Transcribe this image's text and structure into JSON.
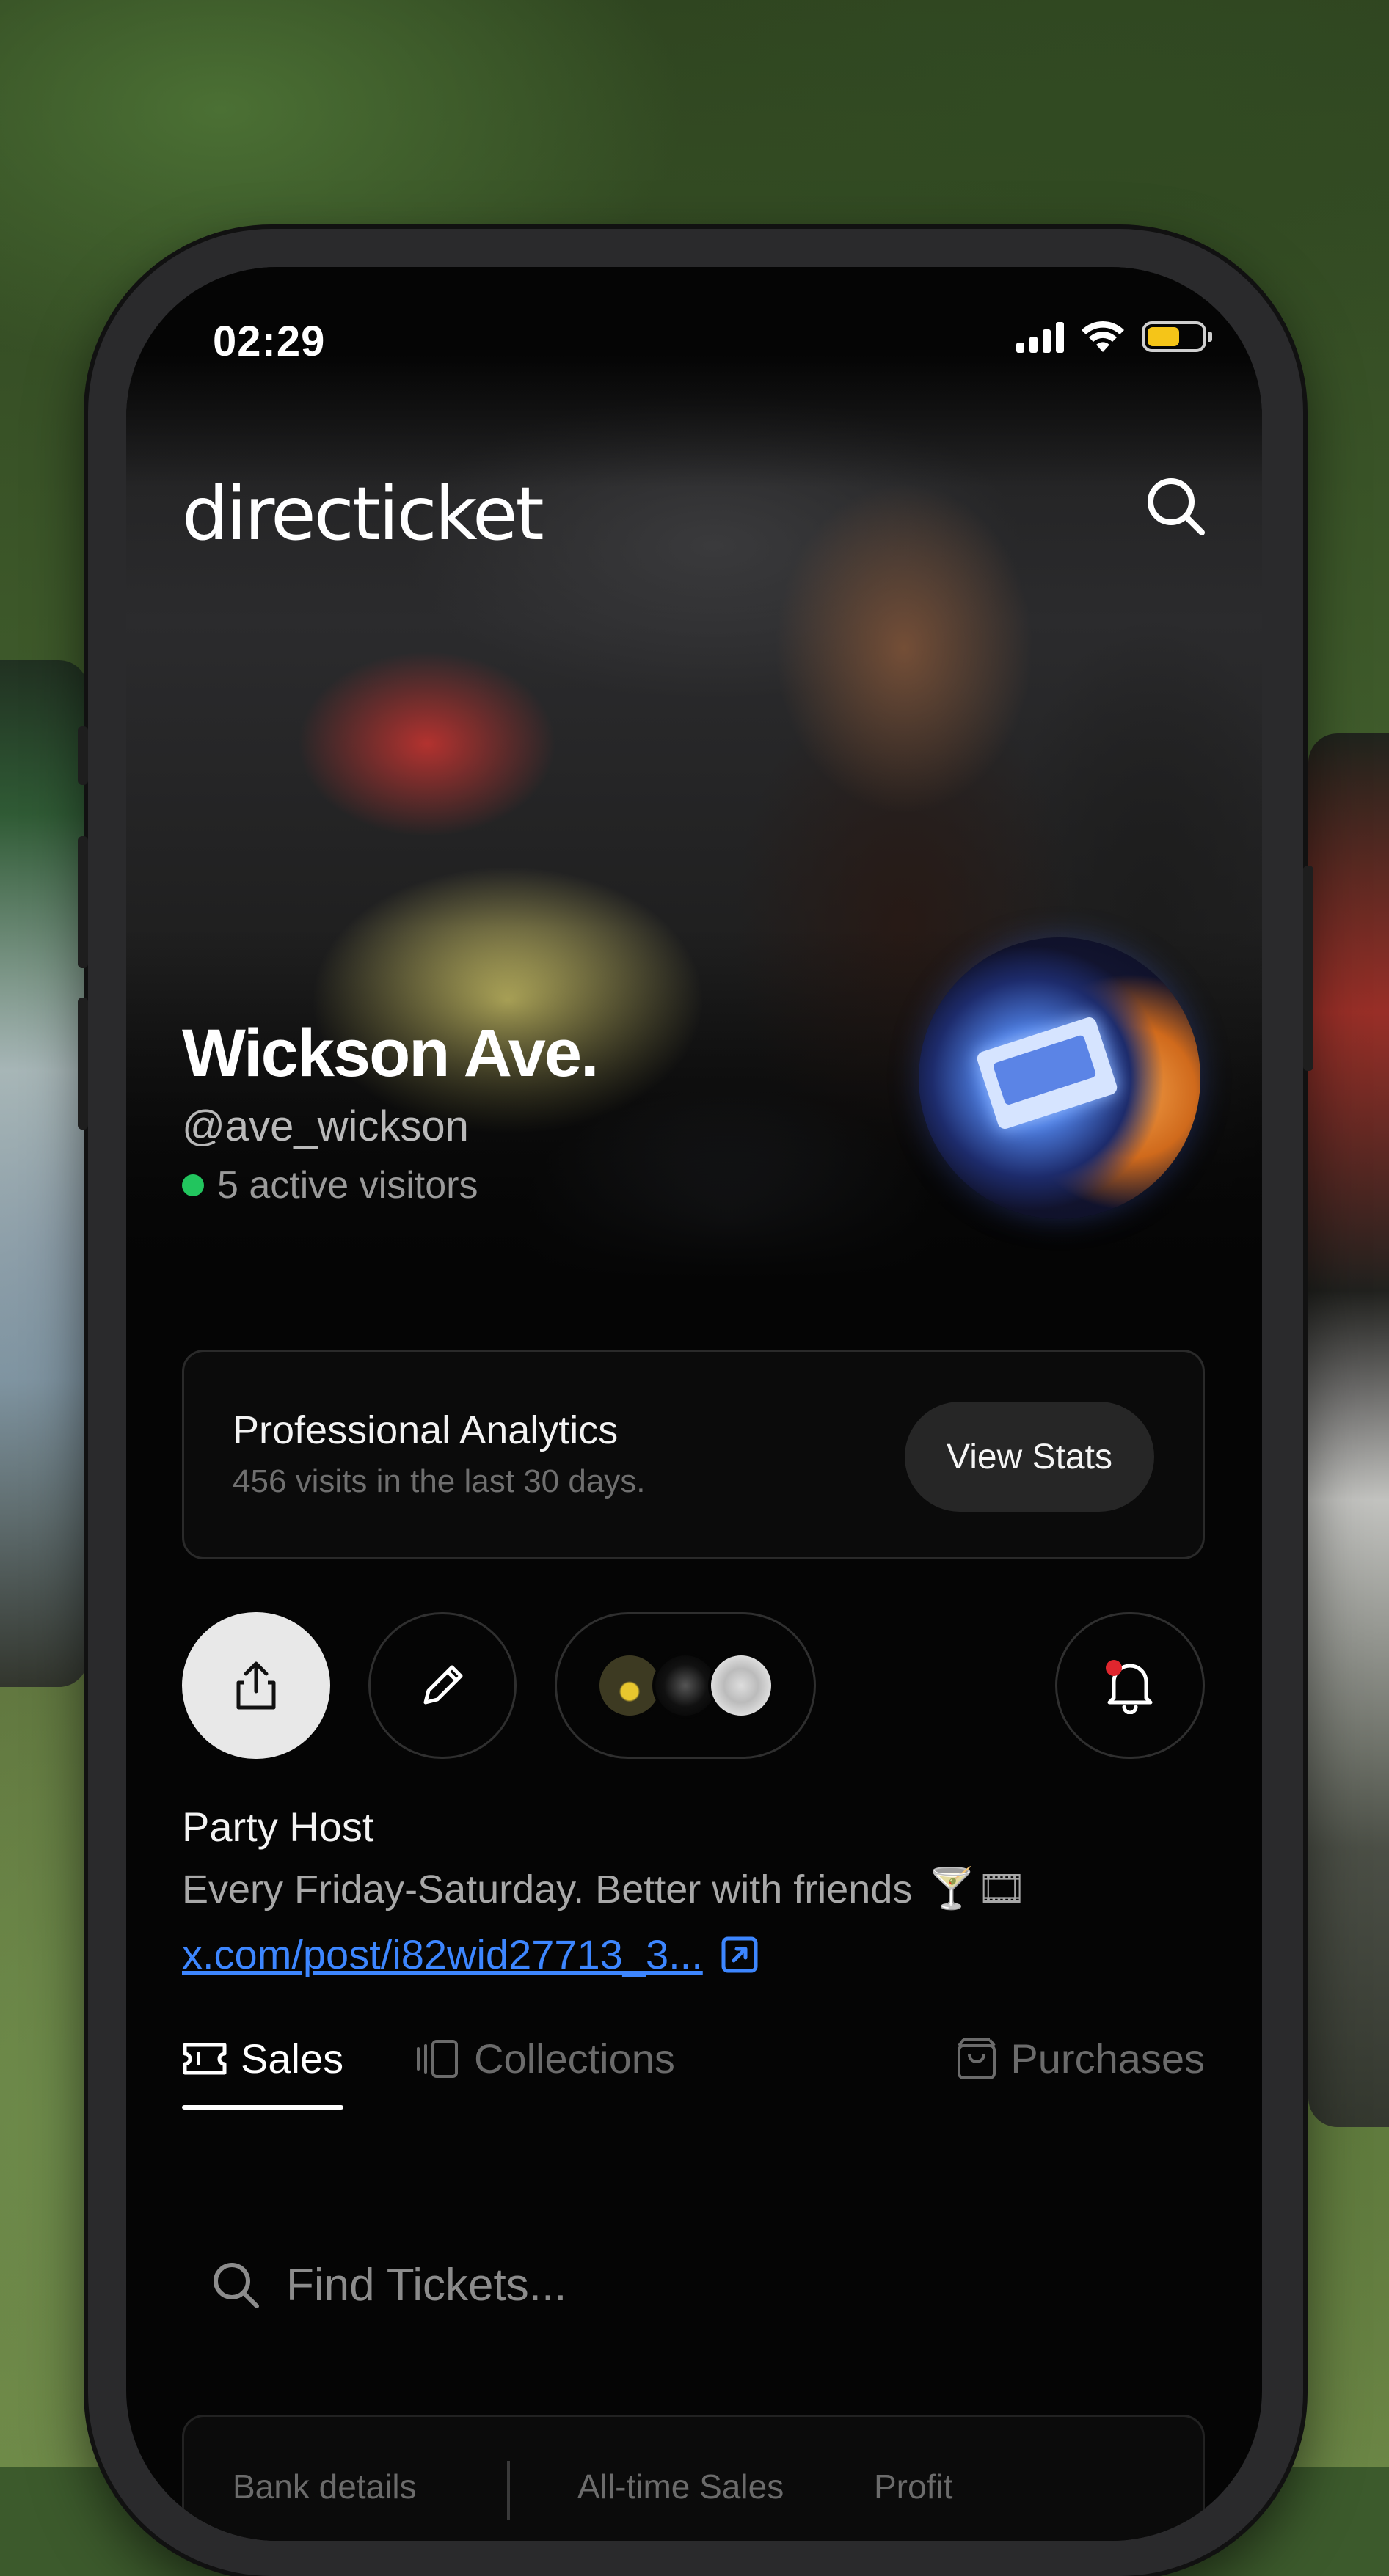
{
  "status_bar": {
    "time": "02:29"
  },
  "app": {
    "logo": "directicket"
  },
  "profile": {
    "name": "Wickson Ave.",
    "handle": "@ave_wickson",
    "active_visitors": "5 active visitors"
  },
  "analytics": {
    "title": "Professional Analytics",
    "subtitle": "456 visits in the last 30 days.",
    "button": "View Stats"
  },
  "bio": {
    "role": "Party Host",
    "text": "Every Friday-Saturday. Better with friends",
    "emoji": "🍸🎞",
    "link": "x.com/post/i82wid27713_3..."
  },
  "tabs": [
    {
      "label": "Sales",
      "icon": "ticket-icon",
      "active": true
    },
    {
      "label": "Collections",
      "icon": "collections-icon",
      "active": false
    },
    {
      "label": "Purchases",
      "icon": "bag-icon",
      "active": false
    }
  ],
  "search": {
    "placeholder": "Find Tickets..."
  },
  "summary": {
    "bank_details": "Bank details",
    "all_time_sales": "All-time Sales",
    "profit": "Profit"
  },
  "colors": {
    "accent_link": "#3d86ff",
    "online_dot": "#22c55e",
    "notification_dot": "#e0262e",
    "battery": "#f5c518"
  }
}
